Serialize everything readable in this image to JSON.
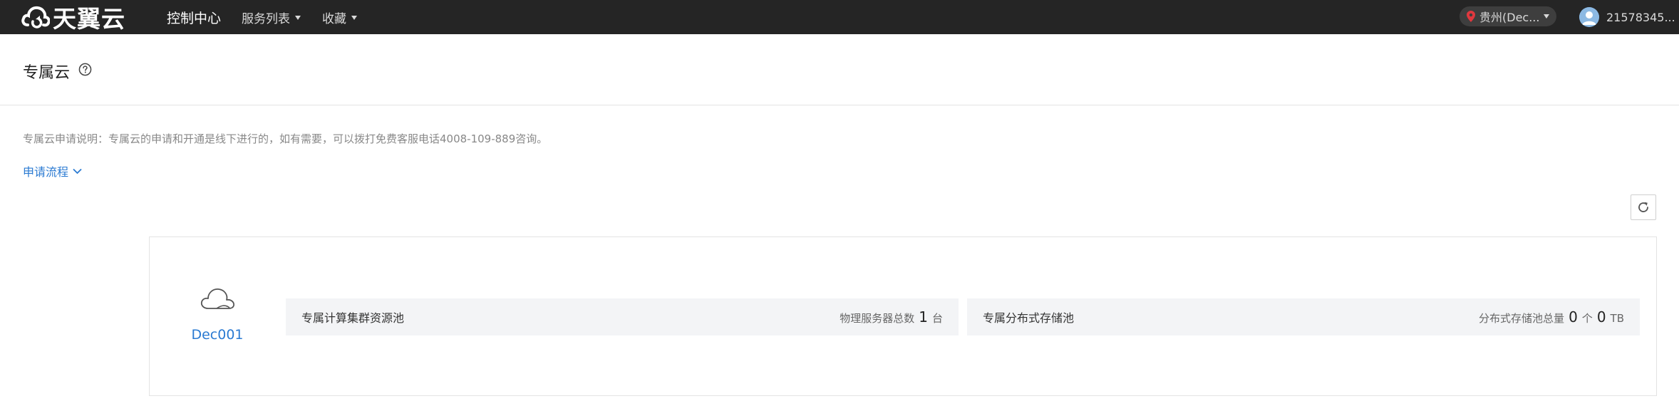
{
  "topbar": {
    "brand": "天翼云",
    "nav": [
      {
        "label": "控制中心"
      },
      {
        "label": "服务列表"
      },
      {
        "label": "收藏"
      }
    ],
    "region": "贵州(Dec...",
    "user": "21578345..."
  },
  "page": {
    "title": "专属云",
    "notice": "专属云申请说明：专属云的申请和开通是线下进行的，如有需要，可以拨打免费客服电话4008-109-889咨询。",
    "apply_flow": "申请流程"
  },
  "card": {
    "name": "Dec001",
    "compute": {
      "label": "专属计算集群资源池",
      "stat_label": "物理服务器总数",
      "count": "1",
      "unit": "台"
    },
    "storage": {
      "label": "专属分布式存储池",
      "stat_label": "分布式存储池总量",
      "count": "0",
      "count_unit": "个",
      "capacity": "0",
      "capacity_unit": "TB"
    }
  },
  "colors": {
    "topbar_bg": "#252525",
    "link": "#2a7ad2",
    "pool_bg": "#f3f4f6"
  }
}
